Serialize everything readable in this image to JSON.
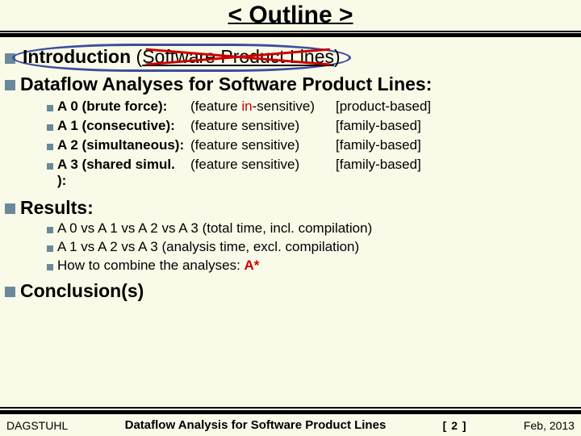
{
  "title": "< Outline >",
  "intro": {
    "label": "Introduction",
    "paren_open": "(",
    "paren_close": ")",
    "struck_text": "Software Product Lines"
  },
  "dataflow": {
    "label": "Dataflow Analyses for Software Product Lines:",
    "rows": [
      {
        "name": "A 0 (brute force):",
        "feat_pre": "(feature ",
        "feat_red": "in",
        "feat_post": "-sensitive)",
        "basis": "[product-based]"
      },
      {
        "name": "A 1 (consecutive):",
        "feat_pre": "(feature sensitive)",
        "feat_red": "",
        "feat_post": "",
        "basis": "[family-based]"
      },
      {
        "name": "A 2 (simultaneous):",
        "feat_pre": "(feature sensitive)",
        "feat_red": "",
        "feat_post": "",
        "basis": "[family-based]"
      },
      {
        "name": "A 3 (shared simul. ):",
        "feat_pre": "(feature sensitive)",
        "feat_red": "",
        "feat_post": "",
        "basis": "[family-based]"
      }
    ]
  },
  "results": {
    "label": "Results:",
    "items": [
      "A 0 vs A 1 vs A 2 vs A 3 (total time, incl. compilation)",
      "A 1 vs A 2 vs A 3 (analysis time, excl. compilation)"
    ],
    "combine_pre": "How to combine the analyses: ",
    "combine_astar": "A*"
  },
  "conclusion": {
    "label": "Conclusion(s)"
  },
  "footer": {
    "left": "DAGSTUHL",
    "mid": "Dataflow Analysis for Software Product Lines",
    "page": "[ 2 ]",
    "right": "Feb, 2013"
  }
}
